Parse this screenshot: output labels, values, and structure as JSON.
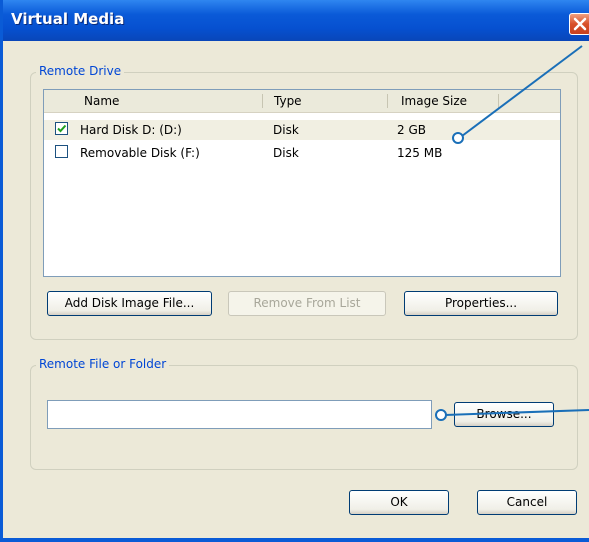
{
  "window": {
    "title": "Virtual Media"
  },
  "remote_drive": {
    "label": "Remote Drive",
    "columns": [
      "Name",
      "Type",
      "Image Size"
    ],
    "rows": [
      {
        "checked": true,
        "name": "Hard Disk D: (D:)",
        "type": "Disk",
        "size": "2 GB"
      },
      {
        "checked": false,
        "name": "Removable Disk (F:)",
        "type": "Disk",
        "size": "125 MB"
      }
    ],
    "buttons": {
      "add": "Add Disk Image File...",
      "remove": "Remove From List",
      "properties": "Properties..."
    }
  },
  "remote_file": {
    "label": "Remote File or Folder",
    "value": "",
    "browse": "Browse..."
  },
  "footer": {
    "ok": "OK",
    "cancel": "Cancel"
  },
  "colors": {
    "title_bar": "#0a5ad8",
    "group_label": "#0046d5",
    "callout_line": "#1a6fb8"
  }
}
